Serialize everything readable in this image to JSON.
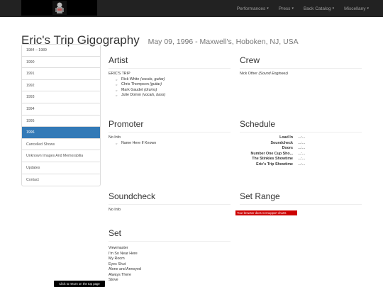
{
  "nav": {
    "items": [
      {
        "label": "Performances"
      },
      {
        "label": "Press"
      },
      {
        "label": "Back Catalog"
      },
      {
        "label": "Miscellany"
      }
    ]
  },
  "header": {
    "title": "Eric's Trip Gigography",
    "subtitle": "May 09, 1996 - Maxwell's, Hoboken, NJ, USA"
  },
  "sidebar": {
    "items": [
      {
        "label": "1984 – 1989"
      },
      {
        "label": "1990"
      },
      {
        "label": "1991"
      },
      {
        "label": "1992"
      },
      {
        "label": "1993"
      },
      {
        "label": "1994"
      },
      {
        "label": "1995"
      },
      {
        "label": "1996",
        "active": true
      },
      {
        "label": "Cancelled Shows"
      },
      {
        "label": "Unknown Images And Memorabilia"
      },
      {
        "label": "Updates"
      },
      {
        "label": "Contact"
      }
    ]
  },
  "artist": {
    "heading": "Artist",
    "name": "ERIC'S TRIP",
    "members": [
      {
        "name": "Rick White",
        "role": "(vocals, guitar)"
      },
      {
        "name": "Chris Thompson",
        "role": "(guitar)"
      },
      {
        "name": "Mark Gaudet",
        "role": "(drums)"
      },
      {
        "name": "Julie Doiron",
        "role": "(vocals, bass)"
      }
    ]
  },
  "crew": {
    "heading": "Crew",
    "name": "Nick Other",
    "role": "(Sound Engineer)"
  },
  "promoter": {
    "heading": "Promoter",
    "info": "No Info",
    "sub_item": "Name Here If Known"
  },
  "schedule": {
    "heading": "Schedule",
    "rows": [
      {
        "label": "Load In",
        "value": "...:..."
      },
      {
        "label": "Soundcheck",
        "value": "...:..."
      },
      {
        "label": "Doors",
        "value": "...:..."
      },
      {
        "label": "Number One Cup Sho...",
        "value": "...:..."
      },
      {
        "label": "The Stinkies Showtime",
        "value": "...:..."
      },
      {
        "label": "Eric's Trip Showtime",
        "value": "...:..."
      }
    ]
  },
  "soundcheck": {
    "heading": "Soundcheck",
    "info": "No Info"
  },
  "set_range": {
    "heading": "Set Range",
    "error": "Your browser does not support charts"
  },
  "set": {
    "heading": "Set",
    "songs": [
      "Viewmaster",
      "I'm So Near Here",
      "My Room",
      "Eyes Shut",
      "Alone and Annoyed",
      "Always There",
      "Stove"
    ]
  },
  "toast": "Click to return on the top page"
}
